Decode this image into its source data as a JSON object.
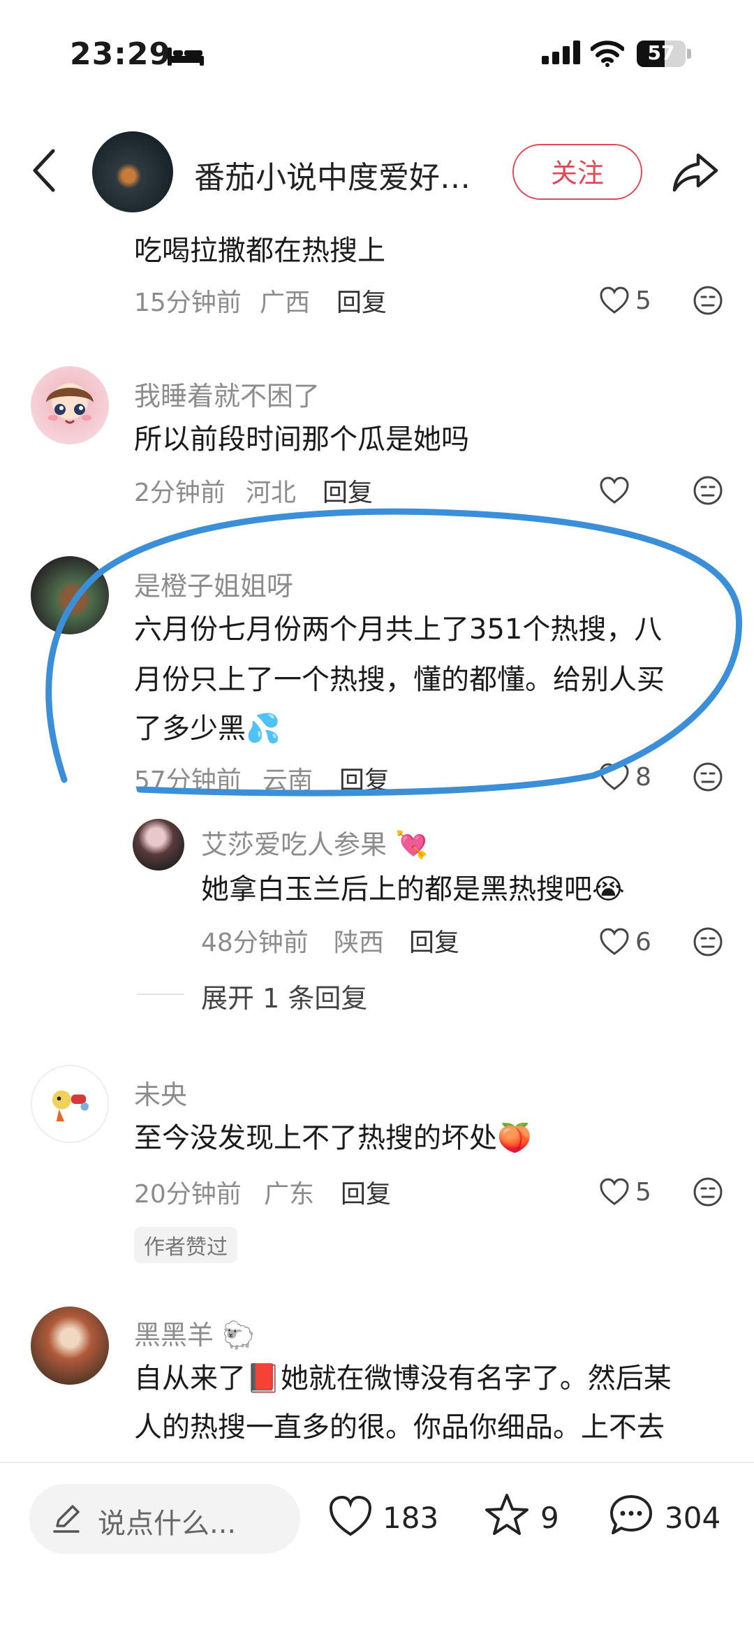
{
  "status": {
    "time": "23:29",
    "battery": "57"
  },
  "header": {
    "title": "番茄小说中度爱好…",
    "follow_label": "关注"
  },
  "comments": [
    {
      "name": "",
      "text": "吃喝拉撒都在热搜上",
      "time": "15分钟前",
      "location": "广西",
      "reply_label": "回复",
      "likes": "5"
    },
    {
      "name": "我睡着就不困了",
      "text": "所以前段时间那个瓜是她吗",
      "time": "2分钟前",
      "location": "河北",
      "reply_label": "回复",
      "likes": ""
    },
    {
      "name": "是橙子姐姐呀",
      "text_line1": "六月份七月份两个月共上了351个热搜，八",
      "text_line2": "月份只上了一个热搜，懂的都懂。给别人买",
      "text_line3": "了多少黑",
      "emoji": "💦",
      "time": "57分钟前",
      "location": "云南",
      "reply_label": "回复",
      "likes": "8",
      "reply": {
        "name": "艾莎爱吃人参果",
        "name_emoji": "💘",
        "text": "她拿白玉兰后上的都是黑热搜吧",
        "text_emoji": "😭",
        "time": "48分钟前",
        "location": "陕西",
        "reply_label": "回复",
        "likes": "6"
      },
      "expand_label": "展开 1 条回复"
    },
    {
      "name": "未央",
      "text": "至今没发现上不了热搜的坏处",
      "text_emoji": "🍑",
      "time": "20分钟前",
      "location": "广东",
      "reply_label": "回复",
      "likes": "5",
      "tag": "作者赞过"
    },
    {
      "name": "黑黑羊",
      "name_emoji": "🐑",
      "text_line1_pre": "自从来了",
      "text_emoji": "📕",
      "text_line1_post": "她就在微博没有名字了。然后某",
      "text_line2": "人的热搜一直多的很。你品你细品。上不去"
    }
  ],
  "bottom": {
    "input_placeholder": "说点什么...",
    "likes": "183",
    "stars": "9",
    "comments": "304"
  },
  "colors": {
    "accent": "#e04a58",
    "annotation": "#3a8fd8",
    "meta_gray": "#8c8c8c"
  },
  "icons": [
    "bed-icon",
    "signal-icon",
    "wifi-icon",
    "battery-icon",
    "back-arrow-icon",
    "share-icon",
    "heart-icon",
    "dislike-face-icon",
    "pen-icon",
    "star-icon",
    "comment-bubble-icon"
  ]
}
